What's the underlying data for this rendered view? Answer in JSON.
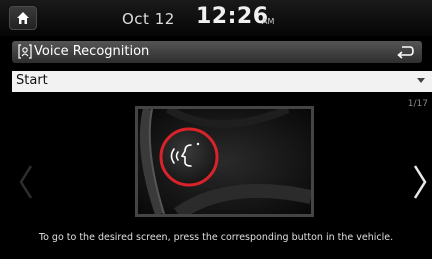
{
  "status": {
    "date": "Oct 12",
    "time": "12:26",
    "ampm": "AM",
    "home_icon": "home-icon"
  },
  "title_bar": {
    "title": "Voice Recognition",
    "icon": "voice-recognition-icon",
    "back_icon": "back-arrow-icon"
  },
  "dropdown": {
    "selected": "Start"
  },
  "page_counter": "1/17",
  "illustration": {
    "icon": "voice-command-button-icon",
    "accent_color": "#d8232a"
  },
  "footer": {
    "instruction": "To go to the desired screen, press the corresponding button in the vehicle."
  },
  "colors": {
    "background": "#000000",
    "title_bar": "#444444",
    "dropdown": "#f2f2f2"
  }
}
